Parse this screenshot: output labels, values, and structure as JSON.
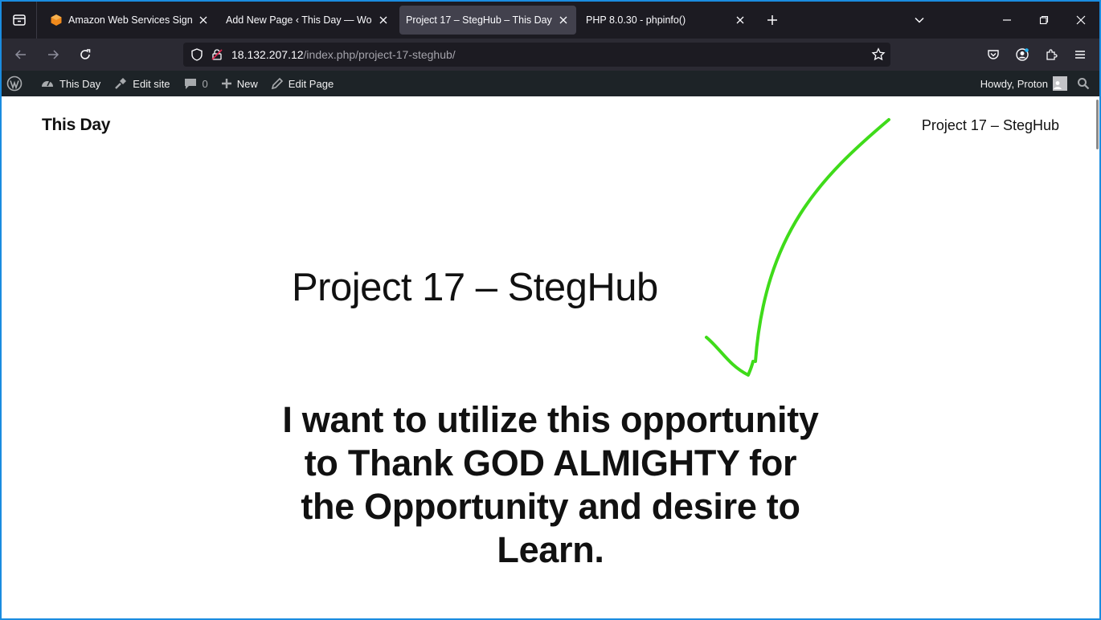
{
  "browser": {
    "tabs": [
      {
        "title": "Amazon Web Services Sign-In",
        "active": false,
        "favicon": "aws-cube-icon"
      },
      {
        "title": "Add New Page ‹ This Day — WordPress",
        "active": false,
        "favicon": "none"
      },
      {
        "title": "Project 17 – StegHub – This Day",
        "active": true,
        "favicon": "none"
      },
      {
        "title": "PHP 8.0.30 - phpinfo()",
        "active": false,
        "favicon": "none"
      }
    ],
    "url": {
      "host": "18.132.207.12",
      "path": "/index.php/project-17-steghub/"
    },
    "accent_color": "#1a8ce0"
  },
  "admin_bar": {
    "site_name": "This Day",
    "edit_site": "Edit site",
    "comments_count": "0",
    "new_label": "New",
    "edit_page": "Edit Page",
    "greeting": "Howdy, Proton"
  },
  "page": {
    "site_title": "This Day",
    "nav_link": "Project 17 – StegHub",
    "heading": "Project 17 – StegHub",
    "quote": "I want to utilize this opportunity to Thank GOD ALMIGHTY for the Opportunity and desire to Learn.",
    "annotation_color": "#3fdb1a"
  }
}
